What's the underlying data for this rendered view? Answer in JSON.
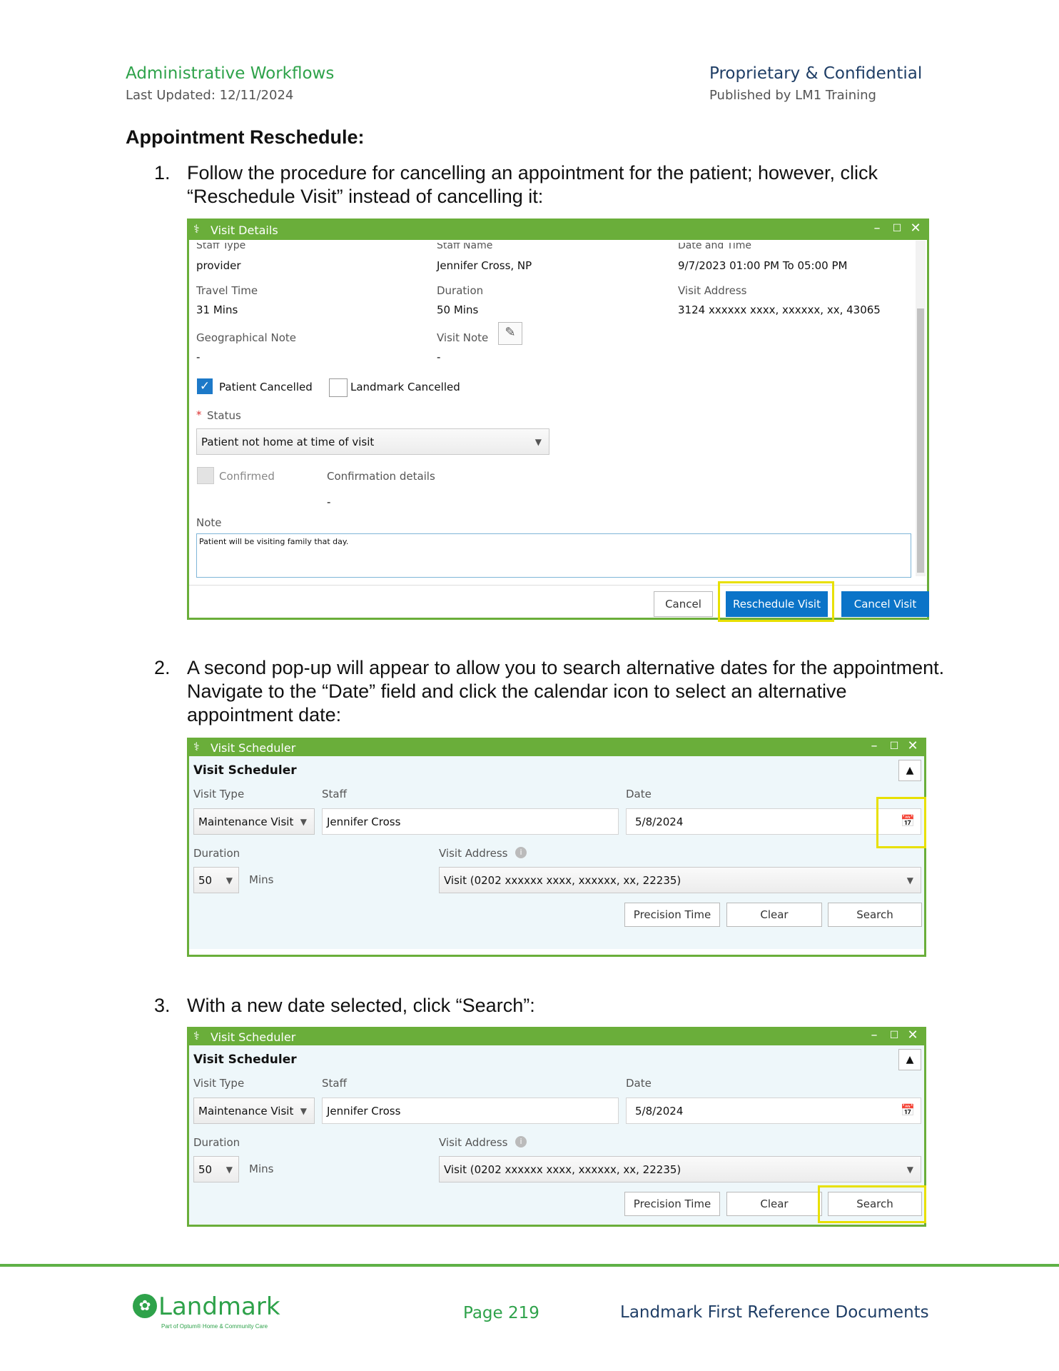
{
  "header": {
    "left_title": "Administrative Workflows",
    "left_sub": "Last Updated: 12/11/2024",
    "right_title": "Proprietary & Confidential",
    "right_sub": "Published by LM1 Training"
  },
  "section_title": "Appointment Reschedule:",
  "steps": [
    {
      "num": "1.",
      "text": "Follow the procedure for cancelling an appointment for the patient; however, click “Reschedule Visit” instead of cancelling it:"
    },
    {
      "num": "2.",
      "text": "A second pop-up will appear to allow you to search alternative dates for the appointment. Navigate to the “Date” field and click the calendar icon to select an alternative appointment date:"
    },
    {
      "num": "3.",
      "text": "With a new date selected, click “Search”:"
    }
  ],
  "visit_details": {
    "title": "Visit Details",
    "window_controls": [
      "–",
      "☐",
      "✕"
    ],
    "staff_type_label": "Staff Type",
    "staff_type": "provider",
    "staff_name_label": "Staff Name",
    "staff_name": "Jennifer Cross, NP",
    "date_time_label": "Date and Time",
    "date_time": "9/7/2023 01:00 PM To 05:00 PM",
    "travel_time_label": "Travel Time",
    "travel_time": "31 Mins",
    "duration_label": "Duration",
    "duration": "50 Mins",
    "visit_address_label": "Visit Address",
    "visit_address": "3124 xxxxxx xxxx, xxxxxx, xx, 43065",
    "geo_note_label": "Geographical Note",
    "geo_note": "-",
    "visit_note_label": "Visit Note",
    "visit_note": "-",
    "patient_cancelled_label": "Patient Cancelled",
    "landmark_cancelled_label": "Landmark Cancelled",
    "status_required": "*",
    "status_label": "Status",
    "status_value": "Patient not home at time of visit",
    "confirmed_label": "Confirmed",
    "confirmation_details_label": "Confirmation details",
    "confirmation_details": "-",
    "note_label": "Note",
    "note_value": "Patient will be visiting family that day.",
    "cancel_button": "Cancel",
    "reschedule_button": "Reschedule Visit",
    "cancel_visit_button": "Cancel Visit",
    "checkmark": "✓",
    "pencil_glyph": "✎"
  },
  "visit_scheduler": {
    "title": "Visit Scheduler",
    "heading": "Visit Scheduler",
    "window_controls": [
      "–",
      "☐",
      "✕"
    ],
    "collapse_glyph": "▲",
    "visit_type_label": "Visit Type",
    "visit_type": "Maintenance Visit",
    "staff_label": "Staff",
    "staff": "Jennifer Cross",
    "date_label": "Date",
    "date": "5/8/2024",
    "duration_label": "Duration",
    "duration": "50",
    "mins_label": "Mins",
    "visit_address_label": "Visit Address",
    "visit_address": "Visit (0202 xxxxxx xxxx, xxxxxx, xx, 22235)",
    "info_glyph": "i",
    "precision_button": "Precision Time",
    "clear_button": "Clear",
    "search_button": "Search",
    "dropdown_glyph": "▼",
    "calendar_glyph": "📅"
  },
  "footer": {
    "logo_text": "Landmark",
    "logo_sub": "Part of Optum® Home & Community Care",
    "page": "Page 219",
    "doc": "Landmark First Reference Documents"
  }
}
